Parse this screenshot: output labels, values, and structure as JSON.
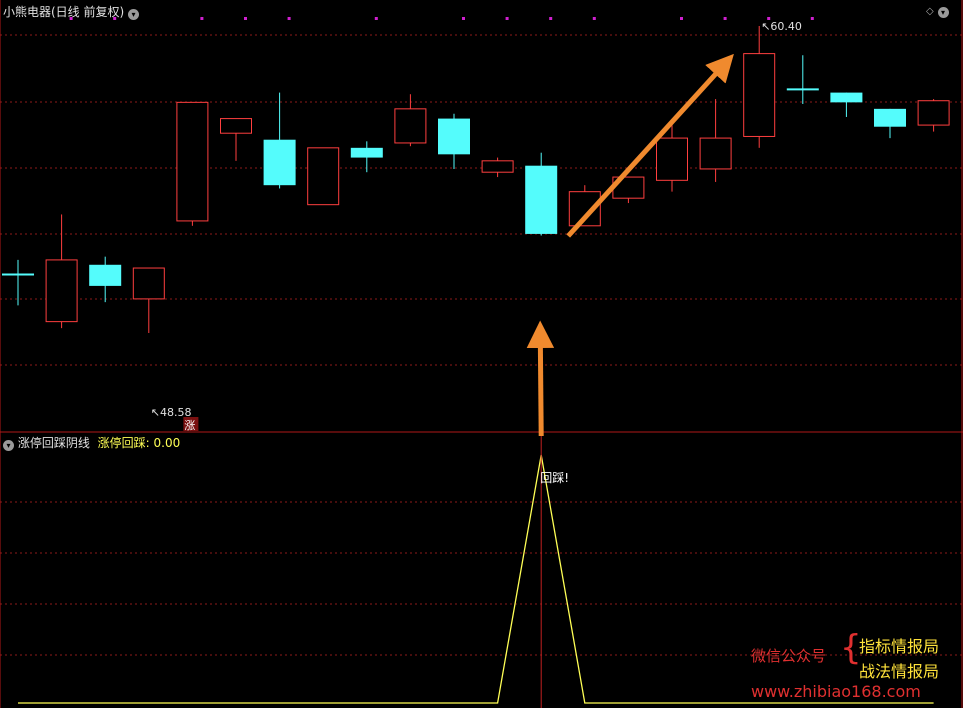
{
  "header": {
    "title": "小熊电器(日线 前复权)",
    "indicator_name": "涨停回踩阴线",
    "indicator_value_label": "涨停回踩:",
    "indicator_value": "0.00"
  },
  "watermark": {
    "line1_left": "微信公众号",
    "line1_right": "指标情报局",
    "line2_right": "战法情报局",
    "url": "www.zhibiao168.com"
  },
  "colors": {
    "up": "#ff3f3f",
    "down": "#54fcfc",
    "grid": "#8c1a1a",
    "indicator_line": "#ffff55",
    "arrow": "#f08a2e",
    "marker_dot": "#d020d0",
    "watermark_red": "#e03030",
    "watermark_yellow": "#ffe23a"
  },
  "chart_data": [
    {
      "type": "candlestick",
      "title": "小熊电器(日线 前复权)",
      "series": [
        {
          "open": 52.75,
          "close": 52.75,
          "high": 53.2,
          "low": 51.8
        },
        {
          "open": 51.3,
          "close": 53.2,
          "high": 54.6,
          "low": 51.1
        },
        {
          "open": 53.05,
          "close": 52.4,
          "high": 53.3,
          "low": 51.9
        },
        {
          "open": 52.0,
          "close": 52.95,
          "high": 52.95,
          "low": 50.95
        },
        {
          "open": 54.4,
          "close": 58.05,
          "high": 58.05,
          "low": 54.25
        },
        {
          "open": 57.1,
          "close": 57.55,
          "high": 57.55,
          "low": 56.25
        },
        {
          "open": 56.9,
          "close": 55.5,
          "high": 58.35,
          "low": 55.4
        },
        {
          "open": 54.9,
          "close": 56.65,
          "high": 56.65,
          "low": 54.9
        },
        {
          "open": 56.65,
          "close": 56.35,
          "high": 56.85,
          "low": 55.9
        },
        {
          "open": 56.8,
          "close": 57.85,
          "high": 58.3,
          "low": 56.7
        },
        {
          "open": 57.55,
          "close": 56.45,
          "high": 57.7,
          "low": 56.0
        },
        {
          "open": 55.9,
          "close": 56.25,
          "high": 56.35,
          "low": 55.75
        },
        {
          "open": 56.1,
          "close": 54.0,
          "high": 56.5,
          "low": 53.95
        },
        {
          "open": 54.25,
          "close": 55.3,
          "high": 55.5,
          "low": 54.25
        },
        {
          "open": 55.1,
          "close": 55.75,
          "high": 55.75,
          "low": 54.95
        },
        {
          "open": 55.65,
          "close": 56.95,
          "high": 57.35,
          "low": 55.3
        },
        {
          "open": 56.0,
          "close": 56.95,
          "high": 58.15,
          "low": 55.6
        },
        {
          "open": 57.0,
          "close": 59.55,
          "high": 60.4,
          "low": 56.65
        },
        {
          "open": 58.45,
          "close": 58.45,
          "high": 59.5,
          "low": 58.0
        },
        {
          "open": 58.35,
          "close": 58.05,
          "high": 58.35,
          "low": 57.6
        },
        {
          "open": 57.85,
          "close": 57.3,
          "high": 57.85,
          "low": 56.95
        },
        {
          "open": 57.35,
          "close": 58.1,
          "high": 58.15,
          "low": 57.15
        }
      ],
      "annotations": {
        "high_label": "60.40",
        "low_label": "48.58",
        "limit_up_marker": "涨"
      }
    },
    {
      "type": "line",
      "title": "涨停回踩阴线",
      "series": [
        {
          "name": "涨停回踩",
          "values": [
            0,
            0,
            0,
            0,
            0,
            0,
            0,
            0,
            0,
            0,
            0,
            0,
            1,
            0,
            0,
            0,
            0,
            0,
            0,
            0,
            0,
            0
          ]
        }
      ],
      "signal_label": "回踩!"
    }
  ]
}
